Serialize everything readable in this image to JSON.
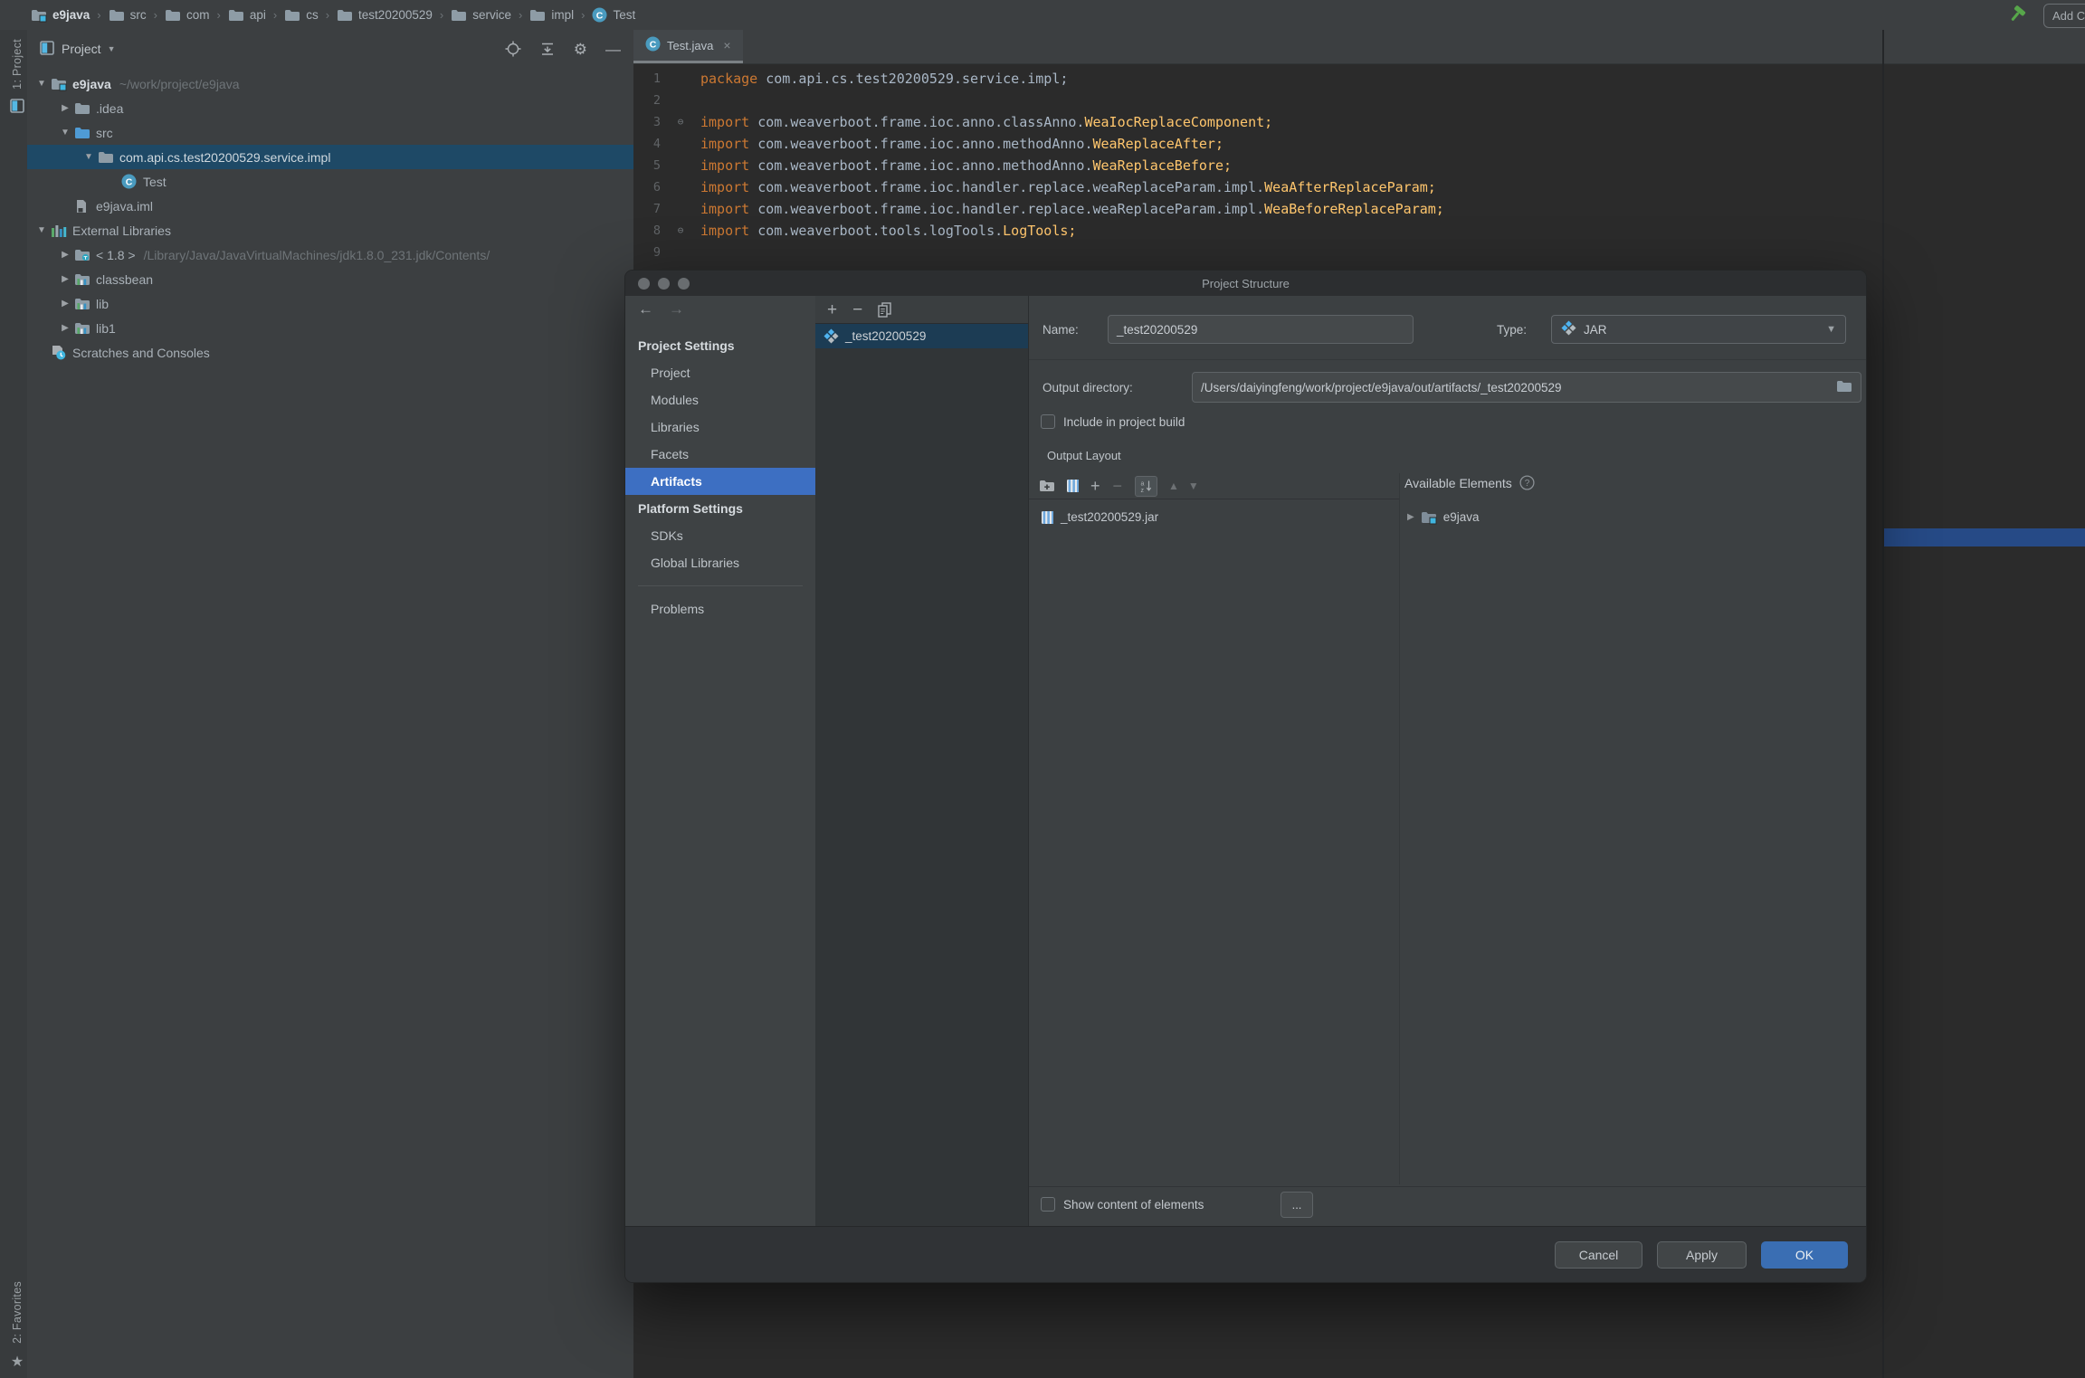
{
  "topbar": {
    "breadcrumbs": [
      {
        "label": "e9java",
        "icon": "project-folder",
        "bold": true
      },
      {
        "label": "src",
        "icon": "folder"
      },
      {
        "label": "com",
        "icon": "folder"
      },
      {
        "label": "api",
        "icon": "folder"
      },
      {
        "label": "cs",
        "icon": "folder"
      },
      {
        "label": "test20200529",
        "icon": "folder"
      },
      {
        "label": "service",
        "icon": "folder"
      },
      {
        "label": "impl",
        "icon": "folder"
      },
      {
        "label": "Test",
        "icon": "class"
      }
    ],
    "add_configuration_label": "Add Configuration..."
  },
  "tool_strips": {
    "left_top_label": "1: Project",
    "left_bottom_label": "2: Favorites"
  },
  "project_panel": {
    "header_title": "Project",
    "tree": [
      {
        "indent": 0,
        "arrow": "down",
        "icon": "project-folder",
        "label": "e9java",
        "hint": "~/work/project/e9java",
        "bold": true
      },
      {
        "indent": 1,
        "arrow": "right",
        "icon": "folder",
        "label": ".idea"
      },
      {
        "indent": 1,
        "arrow": "down",
        "icon": "src-folder",
        "label": "src"
      },
      {
        "indent": 2,
        "arrow": "down",
        "icon": "package-folder",
        "label": "com.api.cs.test20200529.service.impl",
        "selected": true
      },
      {
        "indent": 3,
        "arrow": "none",
        "icon": "class",
        "label": "Test"
      },
      {
        "indent": 1,
        "arrow": "none",
        "icon": "iml-file",
        "label": "e9java.iml"
      },
      {
        "indent": 0,
        "arrow": "down",
        "icon": "libraries",
        "label": "External Libraries"
      },
      {
        "indent": 1,
        "arrow": "right",
        "icon": "jdk-folder",
        "label": "< 1.8 >",
        "hint": "/Library/Java/JavaVirtualMachines/jdk1.8.0_231.jdk/Contents/"
      },
      {
        "indent": 1,
        "arrow": "right",
        "icon": "library",
        "label": "classbean"
      },
      {
        "indent": 1,
        "arrow": "right",
        "icon": "library",
        "label": "lib"
      },
      {
        "indent": 1,
        "arrow": "right",
        "icon": "library",
        "label": "lib1"
      },
      {
        "indent": 0,
        "arrow": "none",
        "icon": "scratches",
        "label": "Scratches and Consoles"
      }
    ]
  },
  "editor": {
    "tab_label": "Test.java",
    "code": [
      {
        "n": "1",
        "fold": false,
        "segs": [
          [
            "kw",
            "package"
          ],
          [
            "pl",
            " com.api.cs.test20200529.service.impl;"
          ]
        ]
      },
      {
        "n": "2",
        "fold": false,
        "segs": []
      },
      {
        "n": "3",
        "fold": true,
        "segs": [
          [
            "kw",
            "import"
          ],
          [
            "pl",
            " com.weaverboot.frame.ioc.anno.classAnno."
          ],
          [
            "cl",
            "WeaIocReplaceComponent;"
          ]
        ]
      },
      {
        "n": "4",
        "fold": false,
        "segs": [
          [
            "kw",
            "import"
          ],
          [
            "pl",
            " com.weaverboot.frame.ioc.anno.methodAnno."
          ],
          [
            "cl",
            "WeaReplaceAfter;"
          ]
        ]
      },
      {
        "n": "5",
        "fold": false,
        "segs": [
          [
            "kw",
            "import"
          ],
          [
            "pl",
            " com.weaverboot.frame.ioc.anno.methodAnno."
          ],
          [
            "cl",
            "WeaReplaceBefore;"
          ]
        ]
      },
      {
        "n": "6",
        "fold": false,
        "segs": [
          [
            "kw",
            "import"
          ],
          [
            "pl",
            " com.weaverboot.frame.ioc.handler.replace.weaReplaceParam.impl."
          ],
          [
            "cl",
            "WeaAfterReplaceParam;"
          ]
        ]
      },
      {
        "n": "7",
        "fold": false,
        "segs": [
          [
            "kw",
            "import"
          ],
          [
            "pl",
            " com.weaverboot.frame.ioc.handler.replace.weaReplaceParam.impl."
          ],
          [
            "cl",
            "WeaBeforeReplaceParam;"
          ]
        ]
      },
      {
        "n": "8",
        "fold": true,
        "segs": [
          [
            "kw",
            "import"
          ],
          [
            "pl",
            " com.weaverboot.tools.logTools."
          ],
          [
            "cl",
            "LogTools;"
          ]
        ]
      },
      {
        "n": "9",
        "fold": false,
        "segs": []
      }
    ]
  },
  "dialog": {
    "title": "Project Structure",
    "nav": {
      "sections": [
        {
          "header": "Project Settings",
          "items": [
            "Project",
            "Modules",
            "Libraries",
            "Facets",
            "Artifacts"
          ]
        },
        {
          "header": "Platform Settings",
          "items": [
            "SDKs",
            "Global Libraries"
          ]
        }
      ],
      "extra_item": "Problems",
      "selected": "Artifacts"
    },
    "artifact_list": [
      {
        "icon": "artifact",
        "label": "_test20200529",
        "selected": true
      }
    ],
    "detail": {
      "name_label": "Name:",
      "name_value": "_test20200529",
      "type_label": "Type:",
      "type_value": "JAR",
      "output_dir_label": "Output directory:",
      "output_dir_value": "/Users/daiyingfeng/work/project/e9java/out/artifacts/_test20200529",
      "include_checkbox_label": "Include in project build",
      "include_checked": false,
      "output_layout_label": "Output Layout",
      "available_elements_label": "Available Elements",
      "layout_tree": [
        {
          "icon": "jar",
          "label": "_test20200529.jar"
        }
      ],
      "available_tree": [
        {
          "icon": "module-folder",
          "label": "e9java",
          "arrow": "right"
        }
      ],
      "show_content_label": "Show content of elements",
      "show_content_checked": false,
      "more_button_label": "..."
    },
    "footer": {
      "cancel": "Cancel",
      "apply": "Apply",
      "ok": "OK"
    }
  },
  "icons": {
    "crumb-separator": "›",
    "tree-expanded": "▼",
    "tree-collapsed": "▶",
    "dropdown-caret": "▼",
    "header-caret": "▼",
    "close": "×",
    "gear": "⚙",
    "minimize": "—",
    "back-arrow": "←",
    "forward-arrow": "→",
    "plus": "+",
    "minus": "−",
    "up-triangle": "▲",
    "down-triangle": "▼",
    "star": "★"
  },
  "colors": {
    "accent_selection": "#3D6FC2",
    "ok_button": "#3A6EB3",
    "tree_selection": "#1E4966",
    "list_selection": "#1C3C54",
    "keyword": "#CC7832",
    "classname": "#FFC66D",
    "code_text": "#A9B7C6",
    "editor_bg": "#2B2B2B",
    "panel_bg": "#3C3F41",
    "background_highlight_bar": "#264A86"
  }
}
